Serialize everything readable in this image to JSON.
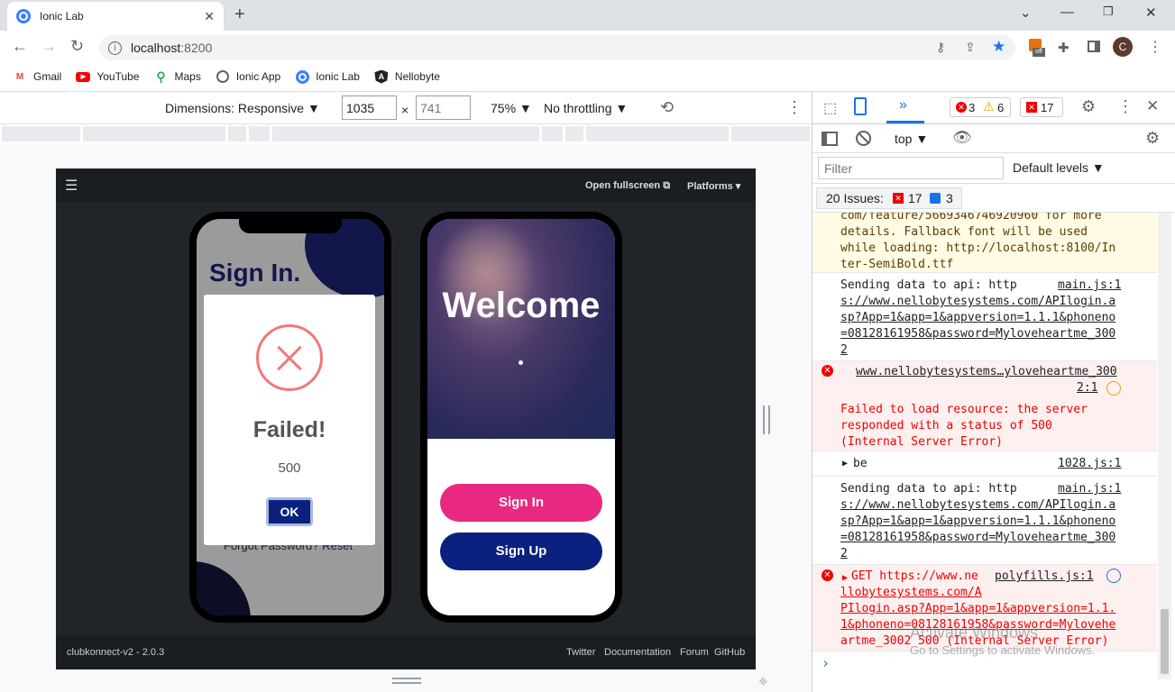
{
  "browser": {
    "tab_title": "Ionic Lab",
    "url_host": "localhost",
    "url_port": ":8200",
    "bookmarks": [
      {
        "label": "Gmail",
        "icon": "gmail-icon"
      },
      {
        "label": "YouTube",
        "icon": "youtube-icon"
      },
      {
        "label": "Maps",
        "icon": "maps-icon"
      },
      {
        "label": "Ionic App",
        "icon": "globe-icon"
      },
      {
        "label": "Ionic Lab",
        "icon": "ionic-icon"
      },
      {
        "label": "Nellobyte",
        "icon": "angular-icon"
      }
    ],
    "avatar_letter": "C",
    "extension_badge": "off"
  },
  "device_toolbar": {
    "dimensions_label": "Dimensions: Responsive ▼",
    "width_value": "1035",
    "times": "×",
    "height_value": "741",
    "zoom": "75% ▼",
    "throttle": "No throttling ▼"
  },
  "lab": {
    "open_fullscreen": "Open fullscreen",
    "platforms": "Platforms ▾",
    "footer_version": "clubkonnect-v2 - 2.0.3",
    "footer_links": [
      "Twitter",
      "Documentation",
      "Forum",
      "GitHub"
    ]
  },
  "phone_left": {
    "heading": "Sign In.",
    "alert_title": "Failed!",
    "alert_message": "500",
    "ok_button": "OK",
    "forgot_text": "Forgot Password?",
    "reset_link": "Reset"
  },
  "phone_right": {
    "welcome": "Welcome",
    "sign_in": "Sign In",
    "sign_up": "Sign Up"
  },
  "devtools": {
    "errors_count": "3",
    "warnings_count": "6",
    "issues_badge_count": "17",
    "context": "top ▼",
    "filter_placeholder": "Filter",
    "levels": "Default levels ▼",
    "issues_label": "20 Issues:",
    "issues_errors": "17",
    "issues_info": "3",
    "messages": [
      {
        "type": "warn",
        "lines": [
          "com/feature/5669346746920960 for more",
          "details. Fallback font will be used",
          "while loading: http://localhost:8100/In",
          "ter-SemiBold.ttf"
        ]
      },
      {
        "type": "log",
        "lines": [
          "Sending data to api: http",
          "s://www.nellobytesystems.com/APIlogin.a",
          "sp?App=1&app=1&appversion=1.1.1&phoneno",
          "=08128161958&password=Myloveheartme_300",
          "2"
        ],
        "source": "main.js:1"
      },
      {
        "type": "error",
        "lines": [
          "www.nellobytesystems…yloveheartme_300",
          "2:1",
          "Failed to load resource: the server",
          "responded with a status of 500",
          "(Internal Server Error)"
        ]
      },
      {
        "type": "log",
        "lines": [
          "be"
        ],
        "source": "1028.js:1"
      },
      {
        "type": "log",
        "lines": [
          "Sending data to api: http",
          "s://www.nellobytesystems.com/APIlogin.a",
          "sp?App=1&app=1&appversion=1.1.1&phoneno",
          "=08128161958&password=Myloveheartme_300",
          "2"
        ],
        "source": "main.js:1"
      },
      {
        "type": "error",
        "lines": [
          "GET https://www.ne",
          "llobytesystems.com/A",
          "PIlogin.asp?App=1&app=1&appversion=1.1.",
          "1&phoneno=08128161958&password=Mylovehe",
          "artme_3002 500 (Internal Server Error)"
        ],
        "source": "polyfills.js:1"
      }
    ],
    "watermark_title": "Activate Windows",
    "watermark_sub": "Go to Settings to activate Windows."
  }
}
